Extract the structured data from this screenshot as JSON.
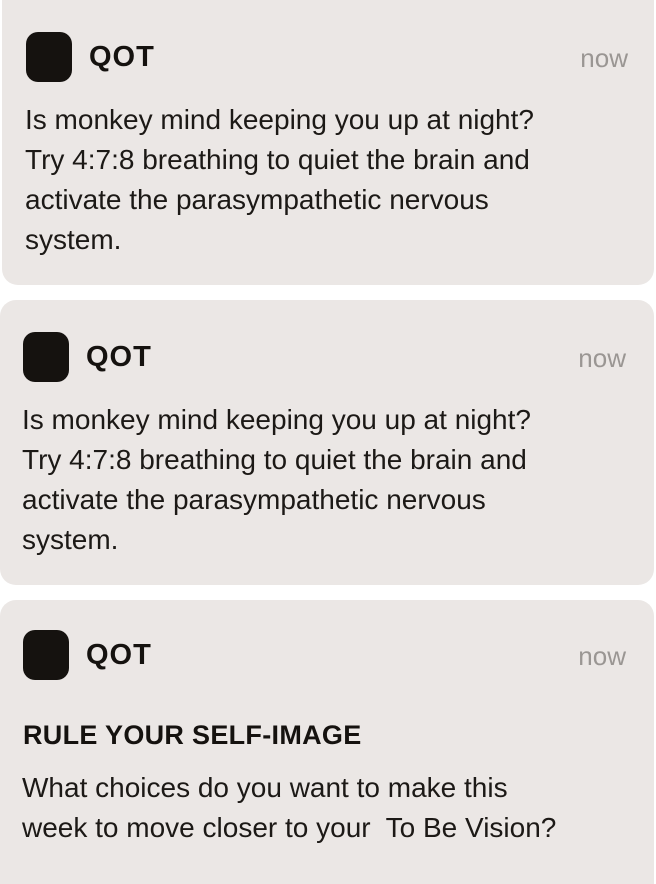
{
  "notifications": [
    {
      "app_name": "QOT",
      "time": "now",
      "body": "Is monkey mind keeping you up at night?\nTry 4:7:8 breathing to quiet the brain and\nactivate the parasympathetic nervous\nsystem."
    },
    {
      "app_name": "QOT",
      "time": "now",
      "body": "Is monkey mind keeping you up at night?\nTry 4:7:8 breathing to quiet the brain and\nactivate the parasympathetic nervous\nsystem."
    },
    {
      "app_name": "QOT",
      "time": "now",
      "title": "RULE YOUR SELF-IMAGE",
      "body": "What choices do you want to make this\nweek to move closer to your  To Be Vision?"
    }
  ],
  "colors": {
    "card_background": "#ebe7e5",
    "app_icon": "#15120f",
    "time_text": "#9a9693",
    "body_text": "#1c1916"
  },
  "icons": {
    "app_icon": "qot-app-icon"
  }
}
